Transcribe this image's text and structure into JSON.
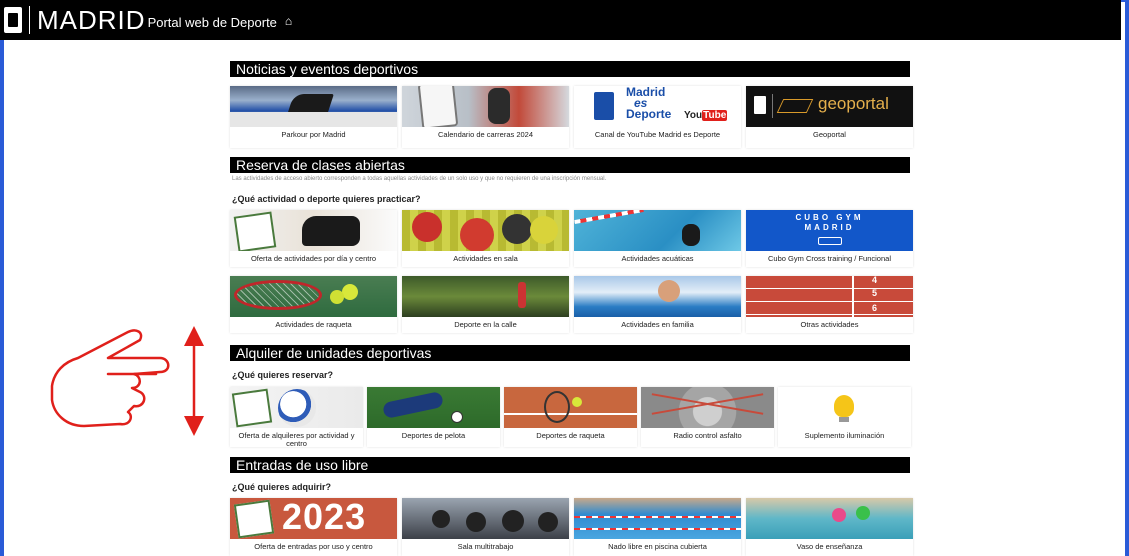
{
  "header": {
    "brand": "MADRID",
    "portal_title": "Portal web de Deporte",
    "home_icon": "home-icon"
  },
  "sections": {
    "noticias": {
      "title": "Noticias y eventos deportivos",
      "cards": [
        {
          "label": "Parkour por Madrid"
        },
        {
          "label": "Calendario de carreras 2024"
        },
        {
          "label": "Canal de YouTube Madrid es Deporte"
        },
        {
          "label": "Geoportal"
        }
      ]
    },
    "reserva": {
      "title": "Reserva de clases abiertas",
      "note": "Las actividades de acceso abierto corresponden a todas aquellas actividades de un solo uso y que no requieren de una inscripción mensual.",
      "question": "¿Qué actividad o deporte quieres practicar?",
      "cards": [
        {
          "label": "Oferta de actividades por día y centro"
        },
        {
          "label": "Actividades en sala"
        },
        {
          "label": "Actividades acuáticas"
        },
        {
          "label": "Cubo Gym Cross training / Funcional"
        },
        {
          "label": "Actividades de raqueta"
        },
        {
          "label": "Deporte en la calle"
        },
        {
          "label": "Actividades en familia"
        },
        {
          "label": "Otras actividades"
        }
      ]
    },
    "alquiler": {
      "title": "Alquiler de unidades deportivas",
      "question": "¿Qué quieres reservar?",
      "cards": [
        {
          "label": "Oferta de alquileres por actividad y centro"
        },
        {
          "label": "Deportes de pelota"
        },
        {
          "label": "Deportes de raqueta"
        },
        {
          "label": "Radio control asfalto"
        },
        {
          "label": "Suplemento iluminación"
        }
      ]
    },
    "entradas": {
      "title": "Entradas de uso libre",
      "question": "¿Qué quieres adquirir?",
      "cards": [
        {
          "label": "Oferta de entradas por uso y centro"
        },
        {
          "label": "Sala multitrabajo"
        },
        {
          "label": "Nado libre en piscina cubierta"
        },
        {
          "label": "Vaso de enseñanza"
        }
      ]
    }
  },
  "images": {
    "geoportal_text": "geoportal",
    "madrid_es_deporte_line1": "Madrid",
    "madrid_es_deporte_line2": "es",
    "madrid_es_deporte_line3": "Deporte",
    "youtube_text": "You",
    "youtube_tube": "Tube",
    "cubo_gym_line1": "CUBO GYM",
    "cubo_gym_line2": "MADRID",
    "year_text": "2023",
    "track_num1": "4",
    "track_num2": "5",
    "track_num3": "6"
  },
  "colors": {
    "header_bg": "#000000",
    "frame_blue": "#2a5bd7",
    "annotation_red": "#e0201b",
    "cubo_blue": "#1257c9"
  }
}
